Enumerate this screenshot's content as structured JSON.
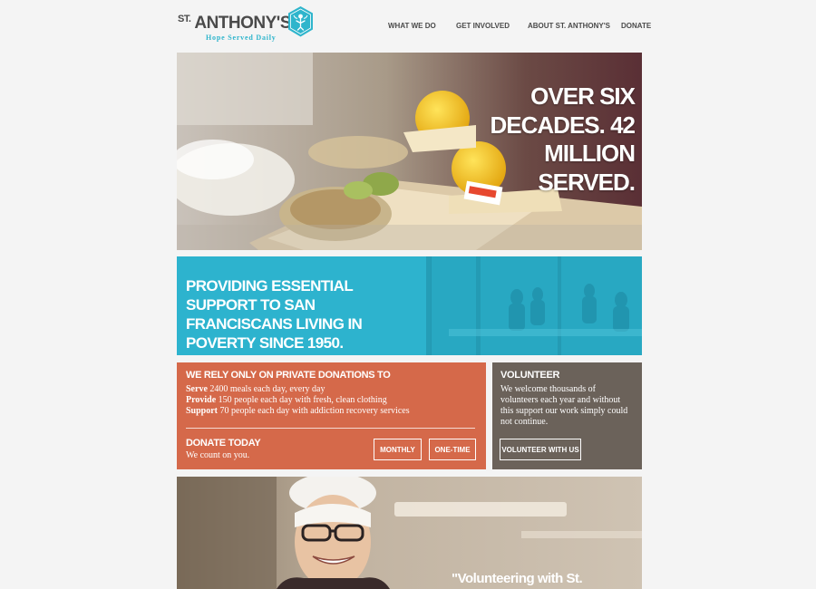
{
  "header": {
    "logo": {
      "st": "ST.",
      "name": "ANTHONY'S",
      "tagline": "Hope Served Daily"
    },
    "nav": [
      {
        "label": "WHAT WE DO"
      },
      {
        "label": "GET INVOLVED"
      },
      {
        "label": "ABOUT ST. ANTHONY'S"
      },
      {
        "label": "DONATE"
      }
    ]
  },
  "hero": {
    "headline": "OVER SIX DECADES. 42 MILLION SERVED."
  },
  "mission": {
    "text": "PROVIDING ESSENTIAL SUPPORT TO SAN FRANCISCANS LIVING IN POVERTY SINCE 1950."
  },
  "donations": {
    "heading": "WE RELY ONLY ON PRIVATE DONATIONS TO",
    "items": [
      {
        "verb": "Serve",
        "rest": "2400 meals each day, every day"
      },
      {
        "verb": "Provide",
        "rest": "150 people each day with fresh, clean clothing"
      },
      {
        "verb": "Support",
        "rest": "70 people each day with addiction recovery services"
      }
    ],
    "donate_title": "DONATE TODAY",
    "donate_sub": "We count on you.",
    "monthly_label": "MONTHLY",
    "onetime_label": "ONE-TIME"
  },
  "volunteer": {
    "heading": "VOLUNTEER",
    "body": "We welcome thousands of volunteers each year and without this support our work simply could not continue.",
    "button_label": "VOLUNTEER WITH US"
  },
  "testimonial": {
    "quote_start": "\"Volunteering with St."
  },
  "colors": {
    "accent_blue": "#2db3ce",
    "donate_orange": "#d5694a",
    "volunteer_gray": "#6b625a",
    "logo_text": "#4a4a4a"
  }
}
